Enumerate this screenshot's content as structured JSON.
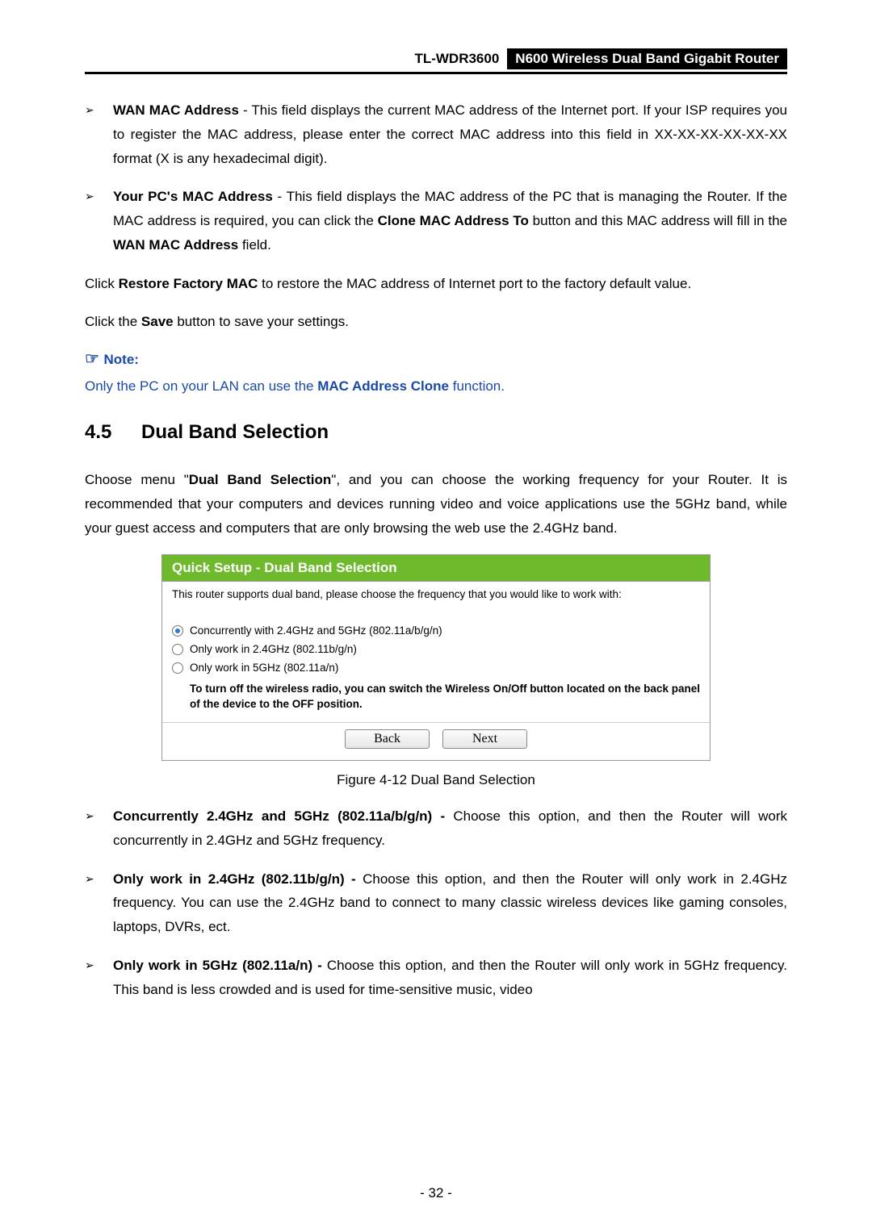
{
  "header": {
    "model": "TL-WDR3600",
    "title": "N600 Wireless Dual Band Gigabit Router"
  },
  "bullets_top": [
    {
      "term": "WAN MAC Address",
      "text": " - This field displays the current MAC address of the Internet port. If your ISP requires you to register the MAC address, please enter the correct MAC address into this field in XX-XX-XX-XX-XX-XX format (X is any hexadecimal digit)."
    },
    {
      "term": "Your PC's MAC Address",
      "text_pre": " - This field displays the MAC address of the PC that is managing the Router. If the MAC address is required, you can click the ",
      "bold1": "Clone MAC Address To",
      "text_mid": " button and this MAC address will fill in the ",
      "bold2": "WAN MAC Address",
      "text_post": " field."
    }
  ],
  "paragraphs": {
    "restore_pre": "Click ",
    "restore_bold": "Restore Factory MAC",
    "restore_post": " to restore the MAC address of Internet port to the factory default value.",
    "save_pre": "Click the ",
    "save_bold": "Save",
    "save_post": " button to save your settings."
  },
  "note": {
    "head": "Note:",
    "body_pre": "Only the PC on your LAN can use the ",
    "body_bold": "MAC Address Clone",
    "body_post": " function."
  },
  "section": {
    "num": "4.5",
    "title": "Dual Band Selection"
  },
  "intro": {
    "pre": "Choose menu \"",
    "bold": "Dual Band Selection",
    "post": "\", and you can choose the working frequency for your Router. It is recommended that your computers and devices running video and voice applications use the 5GHz band, while your guest access and computers that are only browsing the web use the 2.4GHz band."
  },
  "ui": {
    "title": "Quick Setup - Dual Band Selection",
    "desc": "This router supports dual band, please choose the frequency that you would like to work with:",
    "options": [
      {
        "label": "Concurrently with 2.4GHz and 5GHz (802.11a/b/g/n)",
        "checked": true
      },
      {
        "label": "Only work in 2.4GHz (802.11b/g/n)",
        "checked": false
      },
      {
        "label": "Only work in 5GHz (802.11a/n)",
        "checked": false
      }
    ],
    "hint": "To turn off the wireless radio, you can switch the Wireless On/Off button located on the back panel of the device to the OFF position.",
    "buttons": {
      "back": "Back",
      "next": "Next"
    }
  },
  "figure_caption": "Figure 4-12 Dual Band Selection",
  "bullets_bottom": [
    {
      "term": "Concurrently 2.4GHz and 5GHz (802.11a/b/g/n) -",
      "text": " Choose this option, and then the Router will work concurrently in 2.4GHz and 5GHz frequency."
    },
    {
      "term": "Only work in 2.4GHz (802.11b/g/n) -",
      "text": " Choose this option, and then the Router will only work in 2.4GHz frequency. You can use the 2.4GHz band to connect to many classic wireless devices like gaming consoles, laptops, DVRs, ect."
    },
    {
      "term": "Only work in 5GHz (802.11a/n) -",
      "text": " Choose this option, and then the Router will only work in 5GHz frequency. This band is less crowded and is used for time-sensitive music, video"
    }
  ],
  "page_num": "- 32 -"
}
